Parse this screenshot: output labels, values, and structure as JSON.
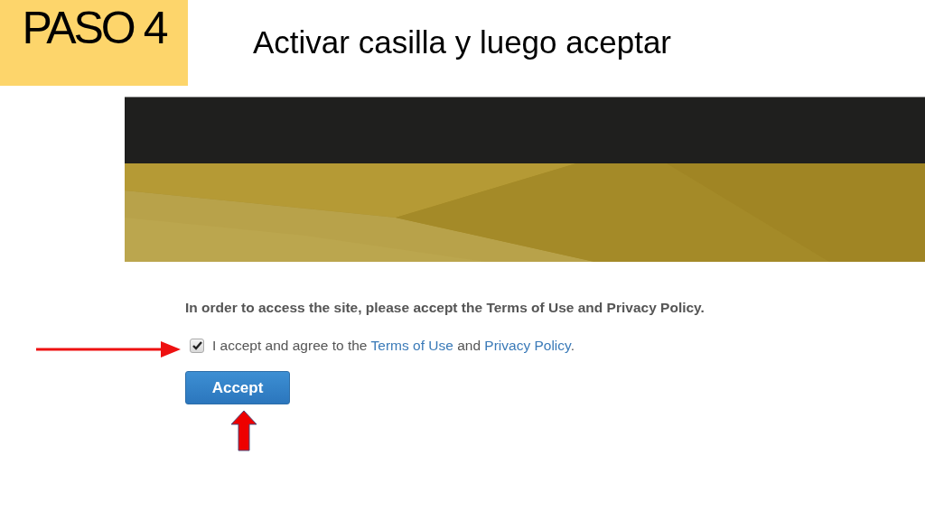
{
  "slide": {
    "step": "PASO 4",
    "title": "Activar casilla y luego aceptar"
  },
  "site": {
    "notice": "In order to access the site, please accept the Terms of Use and Privacy Policy.",
    "agreement": {
      "checked": true,
      "parts": [
        {
          "kind": "text",
          "text": "I accept and agree to the "
        },
        {
          "kind": "link",
          "text": "Terms of Use"
        },
        {
          "kind": "text",
          "text": " and "
        },
        {
          "kind": "link",
          "text": "Privacy Policy"
        },
        {
          "kind": "text",
          "text": "."
        }
      ]
    },
    "button": "Accept"
  }
}
